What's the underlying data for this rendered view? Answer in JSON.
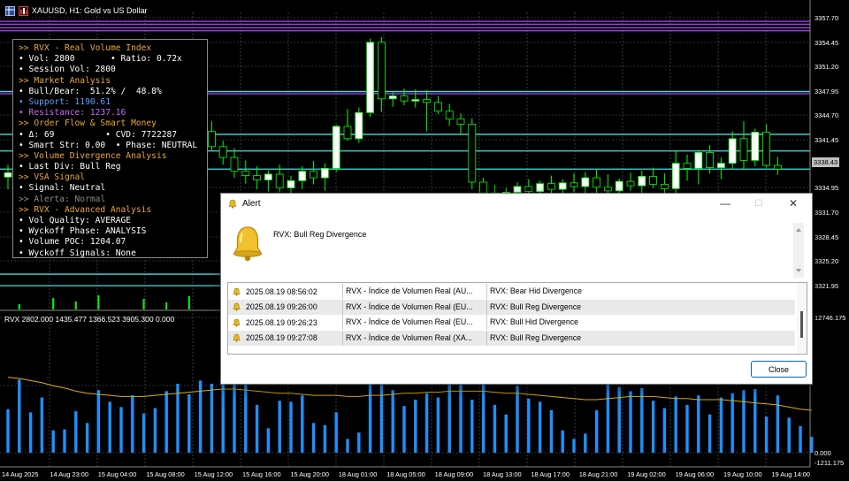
{
  "window": {
    "title": "XAUUSD, H1:  Gold vs US Dollar"
  },
  "colors": {
    "background": "#000000",
    "grid": "#5a6270",
    "bull_candle": "#ffffff",
    "bear_candle": "#000000",
    "candle_outline": "#00ff00",
    "cyan_lines": "#40e0e0",
    "magenta_lines": "#b040ff",
    "volume_bars": "#1e90ff",
    "volume_ma": "#e0b000",
    "panel_heading": "#e8a838",
    "support": "#5aa0ff",
    "resistance": "#cc66ff"
  },
  "info_panel": {
    "lines": [
      {
        "text": ">> RVX - Real Volume Index",
        "color": "#e8a838"
      },
      {
        "text": "• Vol: 2800       • Ratio: 0.72x",
        "color": "#ffffff"
      },
      {
        "text": "• Session Vol: 2800",
        "color": "#ffffff"
      },
      {
        "text": ">> Market Analysis",
        "color": "#e8a838"
      },
      {
        "text": "• Bull/Bear:  51.2% /  48.8%",
        "color": "#ffffff"
      },
      {
        "text": "• Support: 1190.61",
        "color": "#5aa0ff"
      },
      {
        "text": "• Resistance: 1237.16",
        "color": "#cc66ff"
      },
      {
        "text": ">> Order Flow & Smart Money",
        "color": "#e8a838"
      },
      {
        "text": "• Δ: 69          • CVD: 7722287",
        "color": "#ffffff"
      },
      {
        "text": "• Smart Str: 0.00  • Phase: NEUTRAL",
        "color": "#ffffff"
      },
      {
        "text": ">> Volume Divergence Analysis",
        "color": "#e8a838"
      },
      {
        "text": "• Last Div: Bull Reg",
        "color": "#ffffff"
      },
      {
        "text": ">> VSA Signal",
        "color": "#e8a838"
      },
      {
        "text": "• Signal: Neutral",
        "color": "#ffffff"
      },
      {
        "text": ">> Alerta: Normal",
        "color": "#8a8a8a"
      },
      {
        "text": ">> RVX - Advanced Analysis",
        "color": "#e8a838"
      },
      {
        "text": "• Vol Quality: AVERAGE",
        "color": "#ffffff"
      },
      {
        "text": "• Wyckoff Phase: ANALYSIS",
        "color": "#ffffff"
      },
      {
        "text": "• Volume POC: 1204.07",
        "color": "#ffffff"
      },
      {
        "text": "• Wyckoff Signals: None",
        "color": "#ffffff"
      }
    ]
  },
  "price_axis": {
    "labels": [
      "3357.70",
      "3354.45",
      "3351.20",
      "3347.95",
      "3344.70",
      "3341.45",
      "3338.43",
      "3334.95",
      "3331.70",
      "3328.45",
      "3325.20",
      "3321.95"
    ],
    "current_price": "3338.43"
  },
  "indicator": {
    "label": "RVX 2802.000  1435.477  1366.523  3905.300  0.000",
    "axis_labels": [
      "12746.175",
      "0.000",
      "-1211.175"
    ]
  },
  "time_axis": {
    "labels": [
      "14 Aug 2025",
      "14 Aug 23:00",
      "15 Aug 04:00",
      "15 Aug 08:00",
      "15 Aug 12:00",
      "15 Aug 16:00",
      "15 Aug 20:00",
      "18 Aug 01:00",
      "18 Aug 05:00",
      "18 Aug 09:00",
      "18 Aug 13:00",
      "18 Aug 17:00",
      "18 Aug 21:00",
      "19 Aug 02:00",
      "19 Aug 06:00",
      "19 Aug 10:00",
      "19 Aug 14:00"
    ]
  },
  "chart_data": {
    "type": "candlestick",
    "title": "XAUUSD, H1:  Gold vs US Dollar",
    "ylim": [
      3320.0,
      3359.3
    ],
    "candles": [
      {
        "o": 3337.3,
        "h": 3339.0,
        "l": 3335.6,
        "c": 3337.9
      },
      {
        "o": 3337.9,
        "h": 3340.2,
        "l": 3336.6,
        "c": 3339.2
      },
      {
        "o": 3339.2,
        "h": 3340.8,
        "l": 3337.6,
        "c": 3338.1
      },
      {
        "o": 3338.1,
        "h": 3339.5,
        "l": 3336.0,
        "c": 3337.0
      },
      {
        "o": 3337.0,
        "h": 3341.0,
        "l": 3336.5,
        "c": 3340.5
      },
      {
        "o": 3340.5,
        "h": 3342.2,
        "l": 3338.8,
        "c": 3339.6
      },
      {
        "o": 3339.6,
        "h": 3341.5,
        "l": 3337.4,
        "c": 3338.3
      },
      {
        "o": 3338.3,
        "h": 3340.0,
        "l": 3336.3,
        "c": 3339.0
      },
      {
        "o": 3339.0,
        "h": 3340.4,
        "l": 3336.8,
        "c": 3337.4
      },
      {
        "o": 3337.4,
        "h": 3339.1,
        "l": 3335.2,
        "c": 3336.1
      },
      {
        "o": 3336.1,
        "h": 3338.5,
        "l": 3334.5,
        "c": 3337.8
      },
      {
        "o": 3337.8,
        "h": 3339.3,
        "l": 3336.2,
        "c": 3338.5
      },
      {
        "o": 3338.5,
        "h": 3341.5,
        "l": 3337.5,
        "c": 3341.1
      },
      {
        "o": 3341.1,
        "h": 3342.0,
        "l": 3339.0,
        "c": 3340.0
      },
      {
        "o": 3340.0,
        "h": 3341.8,
        "l": 3338.6,
        "c": 3340.8
      },
      {
        "o": 3340.8,
        "h": 3343.3,
        "l": 3339.4,
        "c": 3342.4
      },
      {
        "o": 3342.4,
        "h": 3343.5,
        "l": 3340.4,
        "c": 3341.4
      },
      {
        "o": 3341.4,
        "h": 3344.5,
        "l": 3340.8,
        "c": 3343.6
      },
      {
        "o": 3343.6,
        "h": 3345.0,
        "l": 3341.0,
        "c": 3341.5
      },
      {
        "o": 3341.5,
        "h": 3342.3,
        "l": 3339.0,
        "c": 3340.0
      },
      {
        "o": 3340.0,
        "h": 3341.3,
        "l": 3337.2,
        "c": 3338.1
      },
      {
        "o": 3338.1,
        "h": 3339.6,
        "l": 3336.4,
        "c": 3337.5
      },
      {
        "o": 3337.5,
        "h": 3338.8,
        "l": 3335.6,
        "c": 3336.9
      },
      {
        "o": 3336.9,
        "h": 3338.2,
        "l": 3335.3,
        "c": 3337.7
      },
      {
        "o": 3337.7,
        "h": 3339.0,
        "l": 3335.2,
        "c": 3335.8
      },
      {
        "o": 3335.8,
        "h": 3337.5,
        "l": 3334.4,
        "c": 3336.8
      },
      {
        "o": 3336.8,
        "h": 3338.8,
        "l": 3335.6,
        "c": 3338.1
      },
      {
        "o": 3338.1,
        "h": 3339.5,
        "l": 3336.3,
        "c": 3337.2
      },
      {
        "o": 3337.2,
        "h": 3339.2,
        "l": 3335.4,
        "c": 3338.5
      },
      {
        "o": 3338.5,
        "h": 3344.5,
        "l": 3338.0,
        "c": 3344.3
      },
      {
        "o": 3344.3,
        "h": 3346.7,
        "l": 3342.3,
        "c": 3342.6
      },
      {
        "o": 3342.6,
        "h": 3346.9,
        "l": 3342.0,
        "c": 3346.2
      },
      {
        "o": 3346.2,
        "h": 3356.4,
        "l": 3345.6,
        "c": 3355.9
      },
      {
        "o": 3355.9,
        "h": 3356.6,
        "l": 3346.3,
        "c": 3348.1
      },
      {
        "o": 3348.1,
        "h": 3349.0,
        "l": 3347.0,
        "c": 3348.5
      },
      {
        "o": 3348.5,
        "h": 3349.5,
        "l": 3347.2,
        "c": 3347.8
      },
      {
        "o": 3347.8,
        "h": 3349.4,
        "l": 3346.9,
        "c": 3348.0
      },
      {
        "o": 3348.0,
        "h": 3349.3,
        "l": 3343.6,
        "c": 3347.6
      },
      {
        "o": 3347.6,
        "h": 3348.5,
        "l": 3346.0,
        "c": 3346.4
      },
      {
        "o": 3346.4,
        "h": 3347.4,
        "l": 3344.4,
        "c": 3345.3
      },
      {
        "o": 3345.3,
        "h": 3346.1,
        "l": 3343.2,
        "c": 3344.6
      },
      {
        "o": 3344.6,
        "h": 3345.4,
        "l": 3335.6,
        "c": 3336.6
      },
      {
        "o": 3336.6,
        "h": 3337.2,
        "l": 3333.2,
        "c": 3335.1
      },
      {
        "o": 3335.1,
        "h": 3336.2,
        "l": 3333.4,
        "c": 3334.4
      },
      {
        "o": 3334.4,
        "h": 3335.8,
        "l": 3333.0,
        "c": 3335.2
      },
      {
        "o": 3335.2,
        "h": 3336.6,
        "l": 3334.0,
        "c": 3336.0
      },
      {
        "o": 3336.0,
        "h": 3337.0,
        "l": 3334.5,
        "c": 3335.3
      },
      {
        "o": 3335.3,
        "h": 3336.8,
        "l": 3334.2,
        "c": 3336.4
      },
      {
        "o": 3336.4,
        "h": 3337.5,
        "l": 3334.9,
        "c": 3335.6
      },
      {
        "o": 3335.6,
        "h": 3337.0,
        "l": 3334.4,
        "c": 3336.5
      },
      {
        "o": 3336.5,
        "h": 3337.8,
        "l": 3335.2,
        "c": 3336.0
      },
      {
        "o": 3336.0,
        "h": 3338.0,
        "l": 3334.8,
        "c": 3337.2
      },
      {
        "o": 3337.2,
        "h": 3338.3,
        "l": 3335.0,
        "c": 3335.9
      },
      {
        "o": 3335.9,
        "h": 3337.7,
        "l": 3334.9,
        "c": 3335.4
      },
      {
        "o": 3335.4,
        "h": 3337.1,
        "l": 3334.0,
        "c": 3336.7
      },
      {
        "o": 3336.7,
        "h": 3337.9,
        "l": 3335.4,
        "c": 3336.1
      },
      {
        "o": 3336.1,
        "h": 3338.2,
        "l": 3335.0,
        "c": 3337.4
      },
      {
        "o": 3337.4,
        "h": 3338.6,
        "l": 3335.8,
        "c": 3336.3
      },
      {
        "o": 3336.3,
        "h": 3337.8,
        "l": 3334.6,
        "c": 3335.7
      },
      {
        "o": 3335.7,
        "h": 3340.9,
        "l": 3335.0,
        "c": 3339.2
      },
      {
        "o": 3339.2,
        "h": 3340.4,
        "l": 3336.8,
        "c": 3338.5
      },
      {
        "o": 3338.5,
        "h": 3341.0,
        "l": 3336.3,
        "c": 3340.7
      },
      {
        "o": 3340.7,
        "h": 3341.7,
        "l": 3337.8,
        "c": 3338.6
      },
      {
        "o": 3338.6,
        "h": 3340.0,
        "l": 3337.0,
        "c": 3339.2
      },
      {
        "o": 3339.2,
        "h": 3343.6,
        "l": 3338.4,
        "c": 3342.6
      },
      {
        "o": 3342.6,
        "h": 3345.0,
        "l": 3338.3,
        "c": 3339.6
      },
      {
        "o": 3339.6,
        "h": 3344.0,
        "l": 3338.8,
        "c": 3343.5
      },
      {
        "o": 3343.5,
        "h": 3344.6,
        "l": 3338.6,
        "c": 3338.9
      },
      {
        "o": 3338.9,
        "h": 3340.1,
        "l": 3337.6,
        "c": 3338.4
      }
    ],
    "volume": {
      "series": [
        {
          "name": "RVX",
          "values": [
            4100,
            6900,
            3800,
            5200,
            2100,
            2200,
            3900,
            2800,
            5900,
            4800,
            4300,
            5400,
            3700,
            4200,
            5800,
            6500,
            5500,
            6800,
            6500,
            7100,
            7800,
            6900,
            4500,
            2300,
            4900,
            4800,
            5400,
            2800,
            2600,
            3800,
            1300,
            1900,
            7400,
            7000,
            5900,
            4400,
            5000,
            5600,
            5200,
            6700,
            7200,
            5000,
            6500,
            4500,
            3600,
            6300,
            5100,
            4800,
            4000,
            2100,
            1300,
            1800,
            4000,
            7100,
            6200,
            5800,
            6100,
            4900,
            4200,
            5300,
            4500,
            5400,
            3600,
            5200,
            5600,
            5900,
            6000,
            3400,
            5400,
            3300,
            2500,
            1500
          ]
        },
        {
          "name": "MA",
          "values": [
            7100,
            7000,
            6800,
            6600,
            6300,
            6100,
            5800,
            5600,
            5500,
            5400,
            5300,
            5300,
            5300,
            5400,
            5500,
            5600,
            5700,
            5800,
            5900,
            6000,
            6000,
            5900,
            5800,
            5700,
            5600,
            5600,
            5500,
            5400,
            5400,
            5400,
            5300,
            5300,
            5400,
            5400,
            5500,
            5600,
            5600,
            5700,
            5700,
            5800,
            5800,
            5800,
            5800,
            5700,
            5600,
            5600,
            5500,
            5400,
            5300,
            5200,
            5100,
            5000,
            5000,
            5100,
            5200,
            5300,
            5300,
            5300,
            5200,
            5100,
            5100,
            5000,
            5000,
            5000,
            4900,
            4800,
            4700,
            4600,
            4500,
            4300,
            4100,
            4000
          ]
        }
      ],
      "ylim": [
        -1211.175,
        12746.175
      ]
    },
    "levels": [
      {
        "price": 3358.8,
        "color": "#b040ff"
      },
      {
        "price": 3358.4,
        "color": "#b040ff"
      },
      {
        "price": 3357.9,
        "color": "#b040ff"
      },
      {
        "price": 3357.5,
        "color": "#b040ff"
      },
      {
        "price": 3349.1,
        "color": "#40e0e0"
      },
      {
        "price": 3348.8,
        "color": "#b040ff"
      },
      {
        "price": 3343.2,
        "color": "#40e0e0"
      },
      {
        "price": 3340.9,
        "color": "#40e0e0"
      },
      {
        "price": 3338.4,
        "color": "#40e0e0"
      },
      {
        "price": 3323.9,
        "color": "#40e0e0"
      },
      {
        "price": 3322.3,
        "color": "#40e0e0"
      }
    ],
    "lower_green_ticks": [
      1,
      4,
      6,
      8,
      12,
      14,
      16,
      19,
      22,
      25,
      28,
      31,
      33,
      35,
      38,
      40,
      43,
      46,
      49,
      52,
      55,
      58,
      61,
      64,
      67,
      70
    ]
  },
  "alert_dialog": {
    "title": "Alert",
    "message": "RVX: Bull Reg Divergence",
    "rows": [
      {
        "time": "2025.08.19 08:56:02",
        "source": "RVX - Índice de Volumen Real (AU...",
        "message": "RVX: Bear Hid Divergence"
      },
      {
        "time": "2025.08.19 09:26:00",
        "source": "RVX - Índice de Volumen Real (EU...",
        "message": "RVX: Bull Reg Divergence"
      },
      {
        "time": "2025.08.19 09:26:23",
        "source": "RVX - Índice de Volumen Real (EU...",
        "message": "RVX: Bull Hid Divergence"
      },
      {
        "time": "2025.08.19 09:27:08",
        "source": "RVX - Índice de Volumen Real (XA...",
        "message": "RVX: Bull Reg Divergence"
      }
    ],
    "close_label": "Close",
    "minimize_glyph": "—",
    "maximize_glyph": "☐",
    "close_glyph": "✕"
  }
}
